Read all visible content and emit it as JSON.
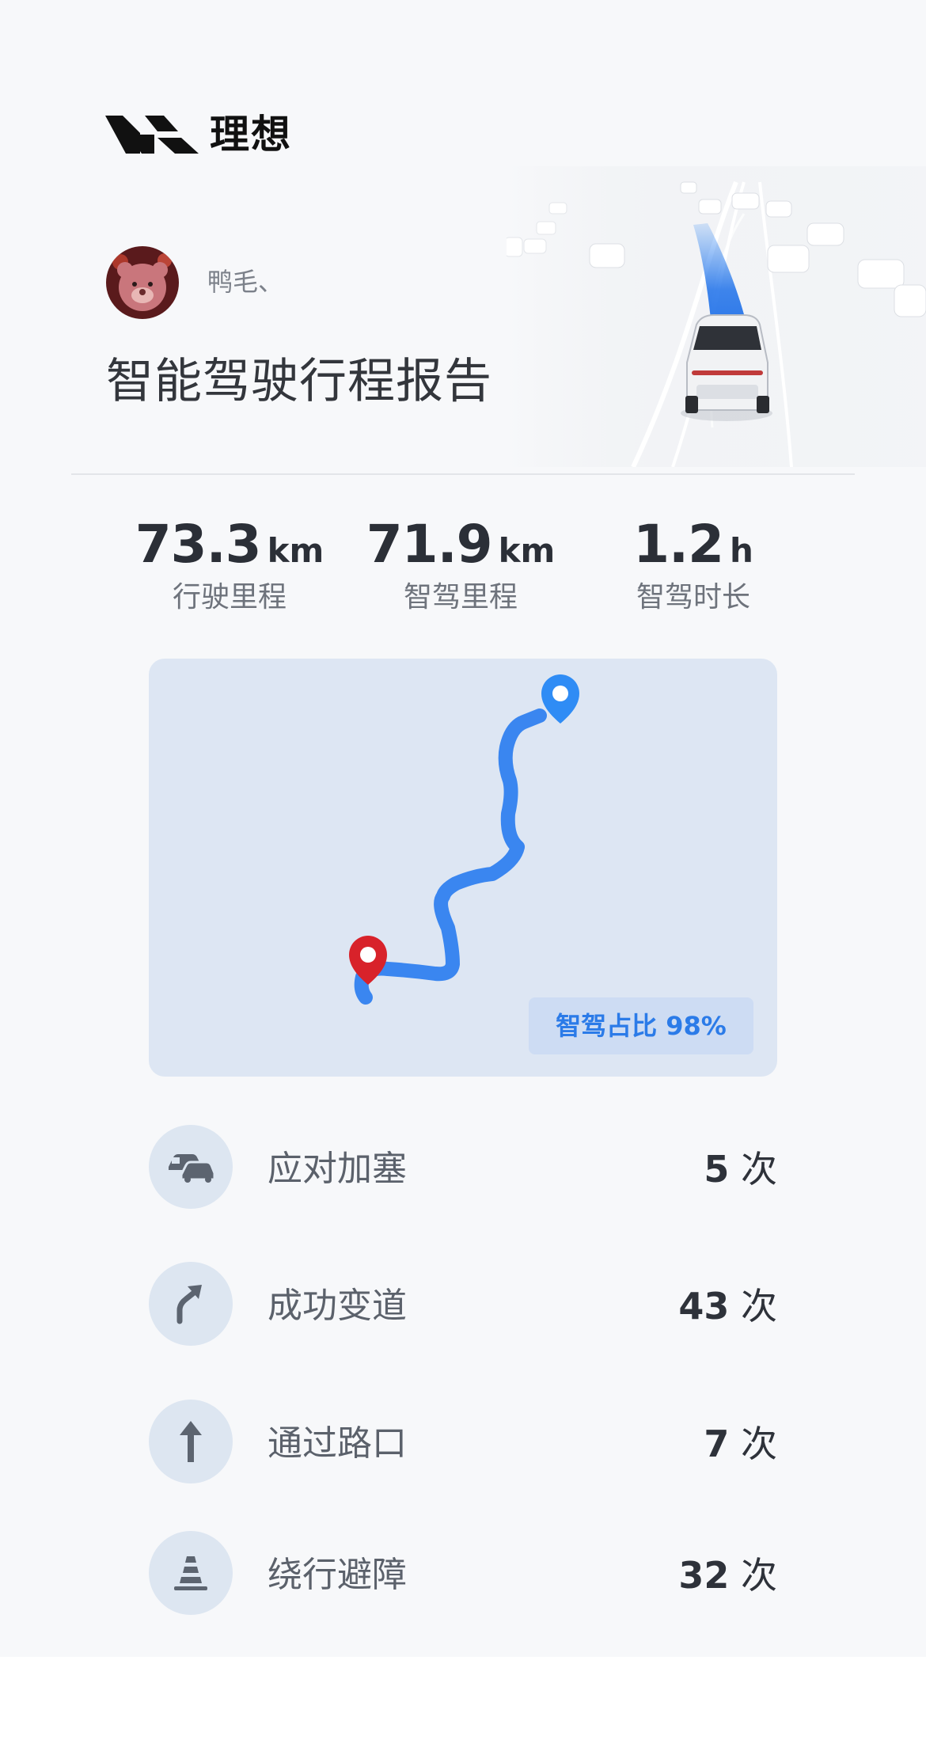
{
  "brand": {
    "name": "理想"
  },
  "user": {
    "name": "鸭毛、"
  },
  "report": {
    "title": "智能驾驶行程报告"
  },
  "stats": [
    {
      "value": "73.3",
      "unit": "km",
      "label": "行驶里程"
    },
    {
      "value": "71.9",
      "unit": "km",
      "label": "智驾里程"
    },
    {
      "value": "1.2",
      "unit": "h",
      "label": "智驾时长"
    }
  ],
  "map": {
    "badge": "智驾占比 98%"
  },
  "events": [
    {
      "icon": "traffic-jam-icon",
      "label": "应对加塞",
      "count": "5",
      "unit": "次"
    },
    {
      "icon": "lane-change-icon",
      "label": "成功变道",
      "count": "43",
      "unit": "次"
    },
    {
      "icon": "straight-arrow-icon",
      "label": "通过路口",
      "count": "7",
      "unit": "次"
    },
    {
      "icon": "traffic-cone-icon",
      "label": "绕行避障",
      "count": "32",
      "unit": "次"
    }
  ],
  "colors": {
    "route": "#3a86f0",
    "start_pin": "#d8222a",
    "end_pin": "#2f8cf5",
    "card_bg": "#f7f8fa",
    "map_bg": "#dde6f3"
  }
}
